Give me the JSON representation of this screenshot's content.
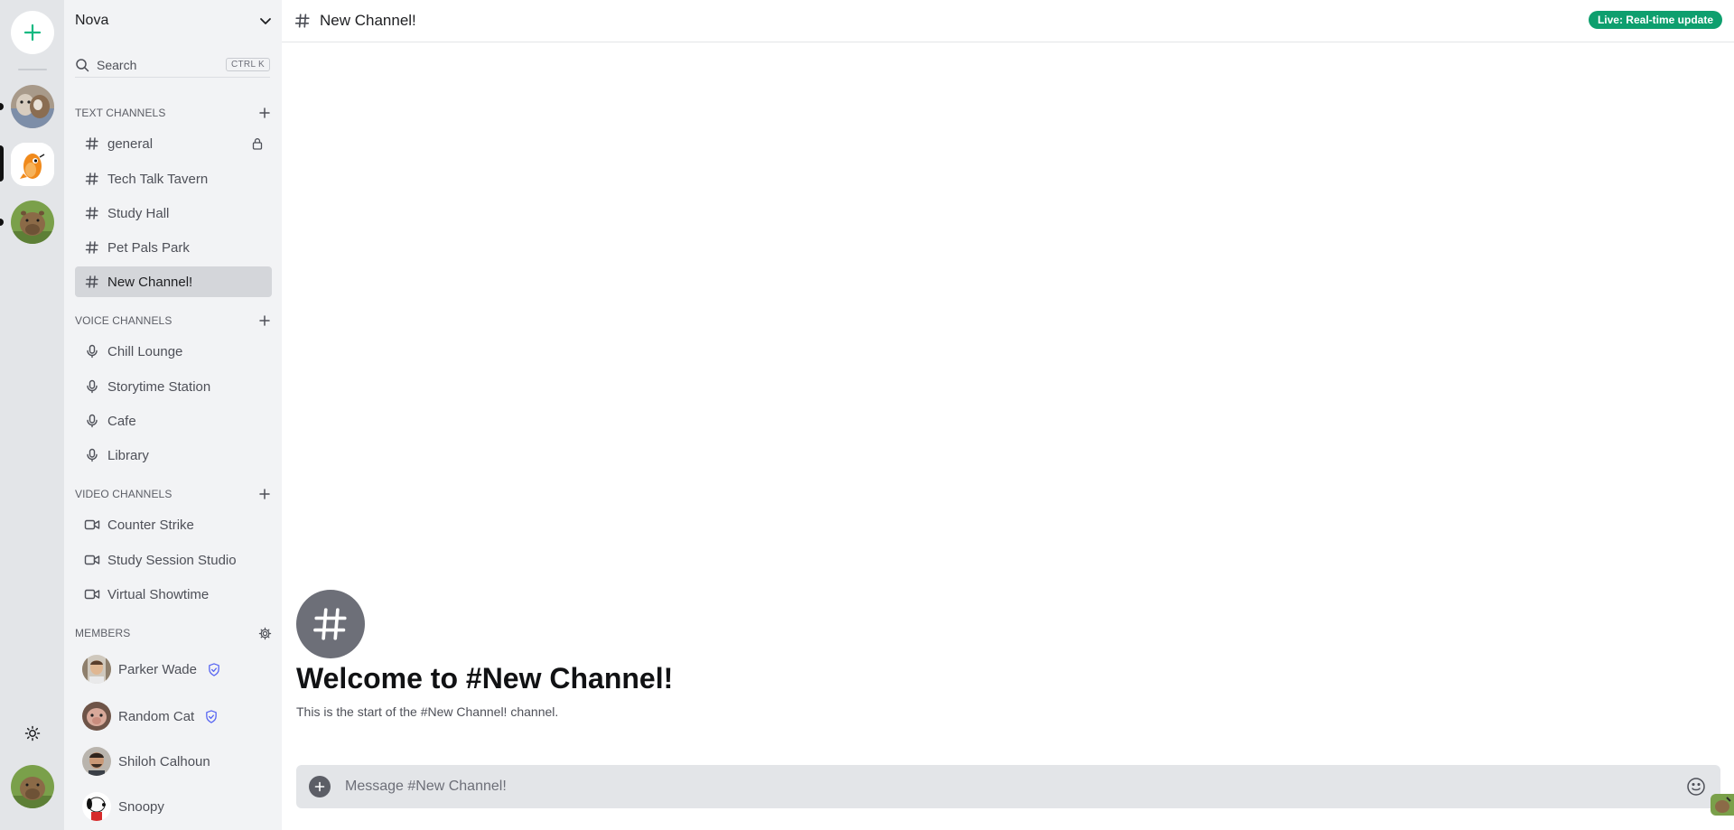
{
  "server": {
    "name": "Nova"
  },
  "search": {
    "placeholder": "Search",
    "shortcut": "CTRL K"
  },
  "text_channels": {
    "title": "TEXT CHANNELS",
    "items": [
      {
        "label": "general",
        "locked": true
      },
      {
        "label": "Tech Talk Tavern"
      },
      {
        "label": "Study Hall"
      },
      {
        "label": "Pet Pals Park"
      },
      {
        "label": "New Channel!",
        "active": true
      }
    ]
  },
  "voice_channels": {
    "title": "VOICE CHANNELS",
    "items": [
      {
        "label": "Chill Lounge"
      },
      {
        "label": "Storytime Station"
      },
      {
        "label": "Cafe"
      },
      {
        "label": "Library"
      }
    ]
  },
  "video_channels": {
    "title": "VIDEO CHANNELS",
    "items": [
      {
        "label": "Counter Strike"
      },
      {
        "label": "Study Session Studio"
      },
      {
        "label": "Virtual Showtime"
      }
    ]
  },
  "members": {
    "title": "MEMBERS",
    "items": [
      {
        "name": "Parker Wade",
        "admin": true
      },
      {
        "name": "Random Cat",
        "admin": true
      },
      {
        "name": "Shiloh Calhoun"
      },
      {
        "name": "Snoopy"
      }
    ]
  },
  "topbar": {
    "channel_name": "New Channel!",
    "live_badge": "Live: Real-time update"
  },
  "welcome": {
    "title": "Welcome to #New Channel!",
    "subtitle": "This is the start of the #New Channel! channel."
  },
  "composer": {
    "placeholder": "Message #New Channel!"
  },
  "colors": {
    "accent": "#0e9f6e",
    "add_server": "#10b981",
    "shield": "#5865f2",
    "active_channel": "#d4d6da"
  }
}
